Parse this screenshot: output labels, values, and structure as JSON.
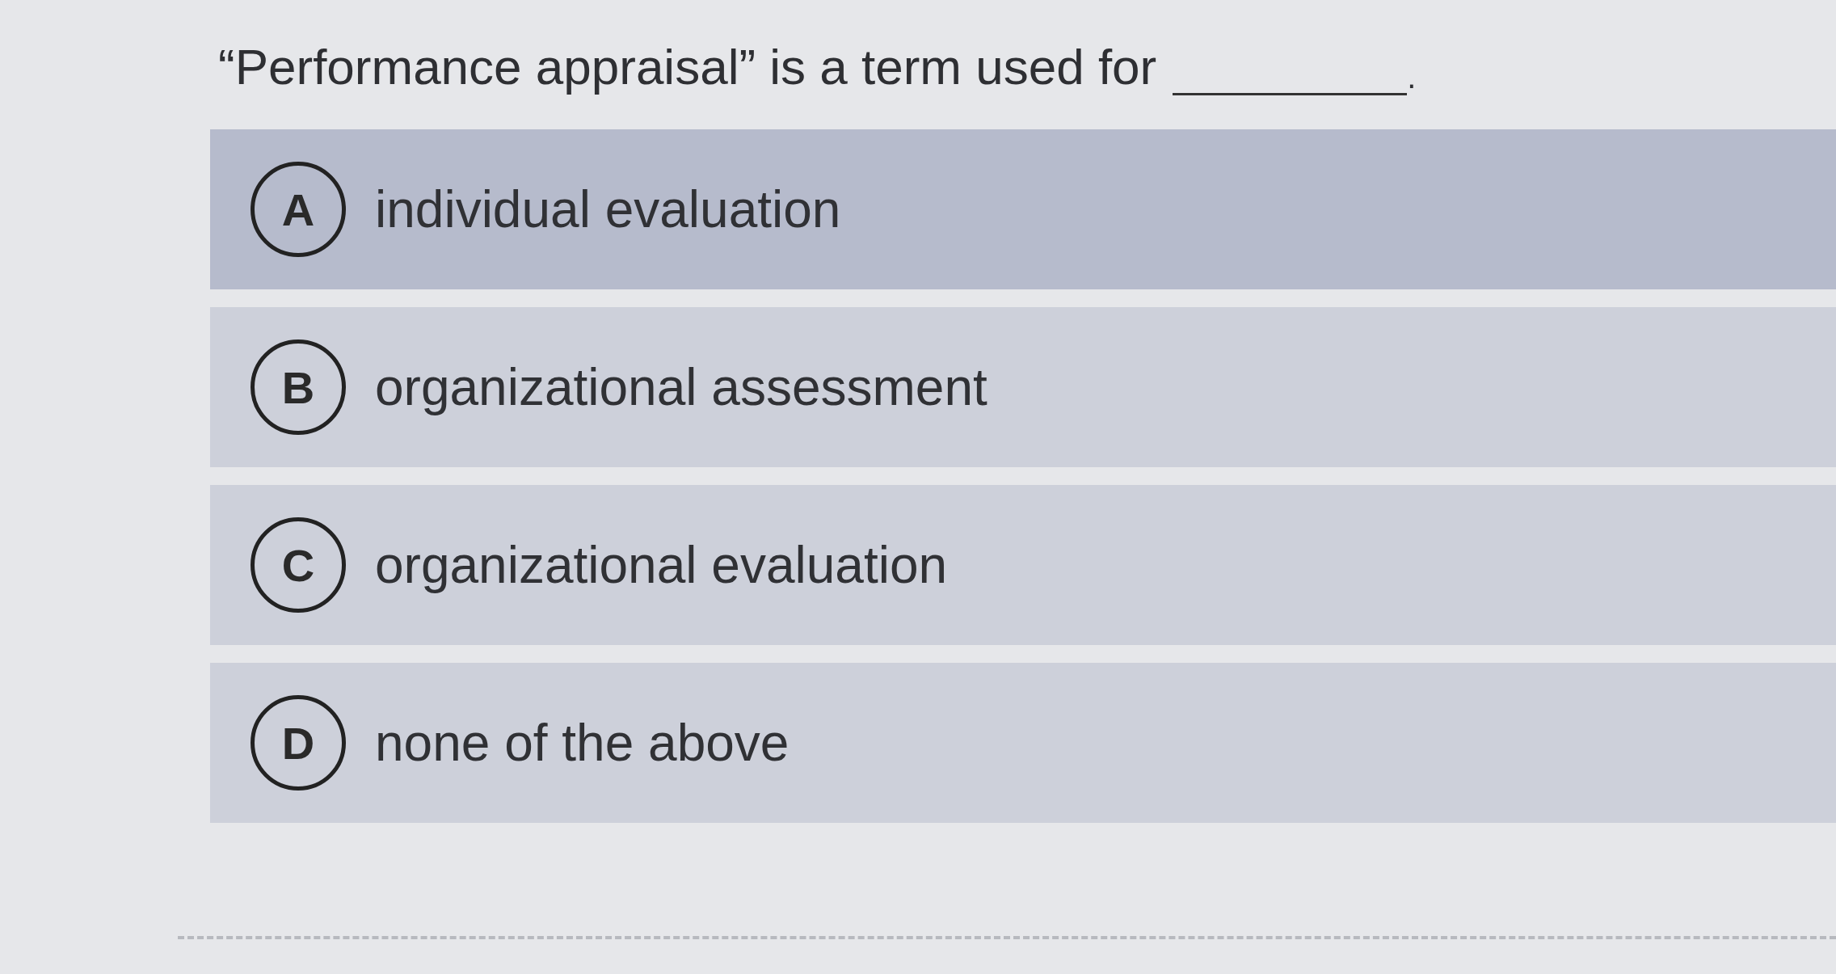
{
  "question": {
    "text": "“Performance appraisal” is a term used for",
    "end": "."
  },
  "options": [
    {
      "letter": "A",
      "text": "individual evaluation",
      "selected": true
    },
    {
      "letter": "B",
      "text": "organizational assessment",
      "selected": false
    },
    {
      "letter": "C",
      "text": "organizational evaluation",
      "selected": false
    },
    {
      "letter": "D",
      "text": "none of the above",
      "selected": false
    }
  ]
}
